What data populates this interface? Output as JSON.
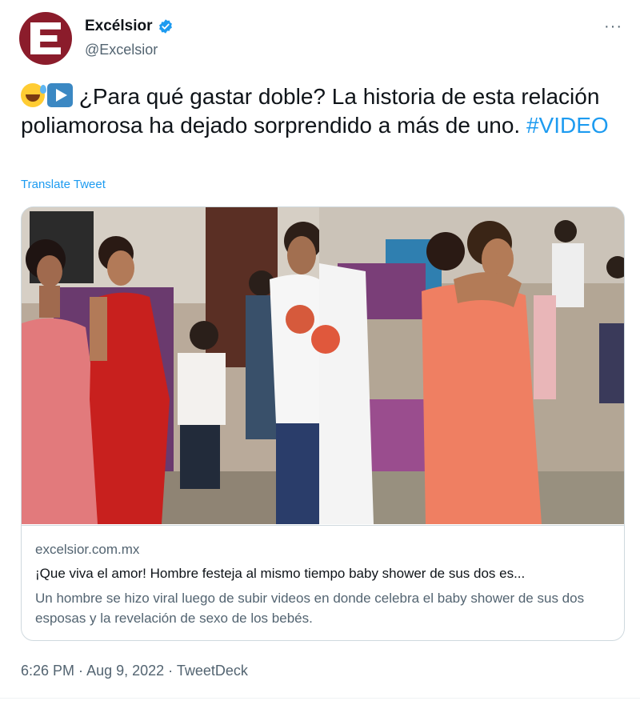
{
  "author": {
    "display_name": "Excélsior",
    "handle": "@Excelsior",
    "avatar_icon": "excelsior-logo-icon",
    "verified_icon": "verified-badge-icon",
    "brand_color": "#8b1c2b"
  },
  "more_label": "···",
  "tweet": {
    "emojis": [
      "grinning-sweat-emoji",
      "play-button-emoji"
    ],
    "text": "¿Para qué gastar doble? La historia de esta relación poliamorosa ha dejado sorprendido a más de uno.",
    "hashtag": "#VIDEO",
    "translate_label": "Translate Tweet"
  },
  "card": {
    "domain": "excelsior.com.mx",
    "title": "¡Que viva el amor! Hombre festeja al mismo tiempo baby shower de sus dos es...",
    "description": "Un hombre se hizo viral luego de subir videos en donde celebra el baby shower de sus dos esposas y la revelación de sexo de los bebés."
  },
  "meta": {
    "time": "6:26 PM",
    "separator": " · ",
    "date": "Aug 9, 2022",
    "source": "TweetDeck"
  },
  "colors": {
    "link": "#1d9bf0",
    "secondary_text": "#536471",
    "border": "#cfd9de"
  }
}
